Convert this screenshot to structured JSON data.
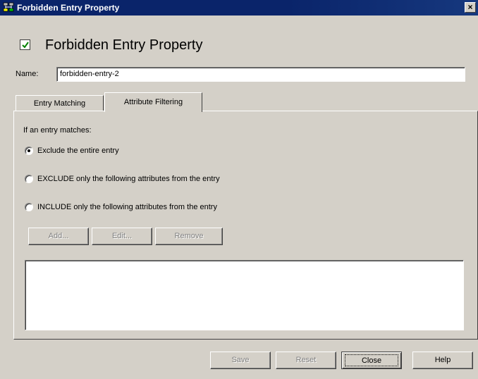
{
  "window": {
    "title": "Forbidden Entry Property",
    "close_glyph": "×",
    "icon": "network-tree-icon"
  },
  "header": {
    "checked": true,
    "title": "Forbidden Entry Property"
  },
  "name_field": {
    "label": "Name:",
    "value": "forbidden-entry-2"
  },
  "tabs": [
    {
      "label": "Entry Matching",
      "selected": false
    },
    {
      "label": "Attribute Filtering",
      "selected": true
    }
  ],
  "panel": {
    "intro": "If an entry matches:",
    "options": [
      {
        "label": "Exclude the entire entry",
        "selected": true
      },
      {
        "label": "EXCLUDE only the following attributes from the entry",
        "selected": false
      },
      {
        "label": "INCLUDE only the following attributes from the entry",
        "selected": false
      }
    ],
    "buttons": {
      "add": "Add...",
      "edit": "Edit...",
      "remove": "Remove"
    },
    "attribute_list": []
  },
  "footer": {
    "save": "Save",
    "reset": "Reset",
    "close": "Close",
    "help": "Help"
  },
  "colors": {
    "titlebar": "#0a246a",
    "face": "#d4d0c8",
    "check_mark": "#008000"
  }
}
